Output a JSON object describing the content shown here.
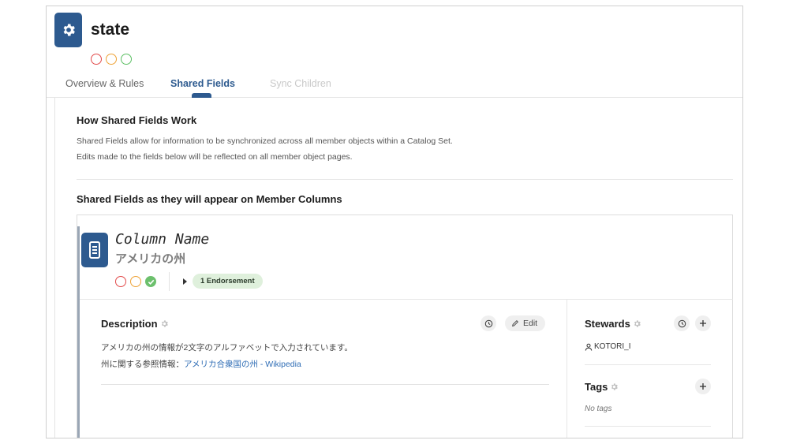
{
  "header": {
    "title": "state",
    "icon": "gear-icon",
    "status_colors": [
      "#e24a4a",
      "#eea236",
      "#5bbf63"
    ]
  },
  "tabs": [
    {
      "label": "Overview & Rules",
      "active": false
    },
    {
      "label": "Shared Fields",
      "active": true
    },
    {
      "label": "Sync Children",
      "active": false,
      "disabled": true
    }
  ],
  "intro": {
    "heading": "How Shared Fields Work",
    "line1": "Shared Fields allow for information to be synchronized across all member objects within a Catalog Set.",
    "line2": "Edits made to the fields below will be reflected on all member object pages."
  },
  "preview": {
    "heading": "Shared Fields as they will appear on Member Columns"
  },
  "column": {
    "name": "Column Name",
    "subtitle": "アメリカの州",
    "endorsement": "1 Endorsement"
  },
  "description": {
    "heading": "Description",
    "edit_label": "Edit",
    "line1": "アメリカの州の情報が2文字のアルファベットで入力されています。",
    "line2_prefix": "州に関する参照情報：",
    "line2_link": "アメリカ合衆国の州 - Wikipedia"
  },
  "stewards": {
    "heading": "Stewards",
    "users": [
      "KOTORI_I"
    ]
  },
  "tags": {
    "heading": "Tags",
    "empty_text": "No tags"
  },
  "colors": {
    "accent": "#2d5a8f",
    "link": "#2f6db5",
    "endorse_bg": "#dff0dc"
  }
}
